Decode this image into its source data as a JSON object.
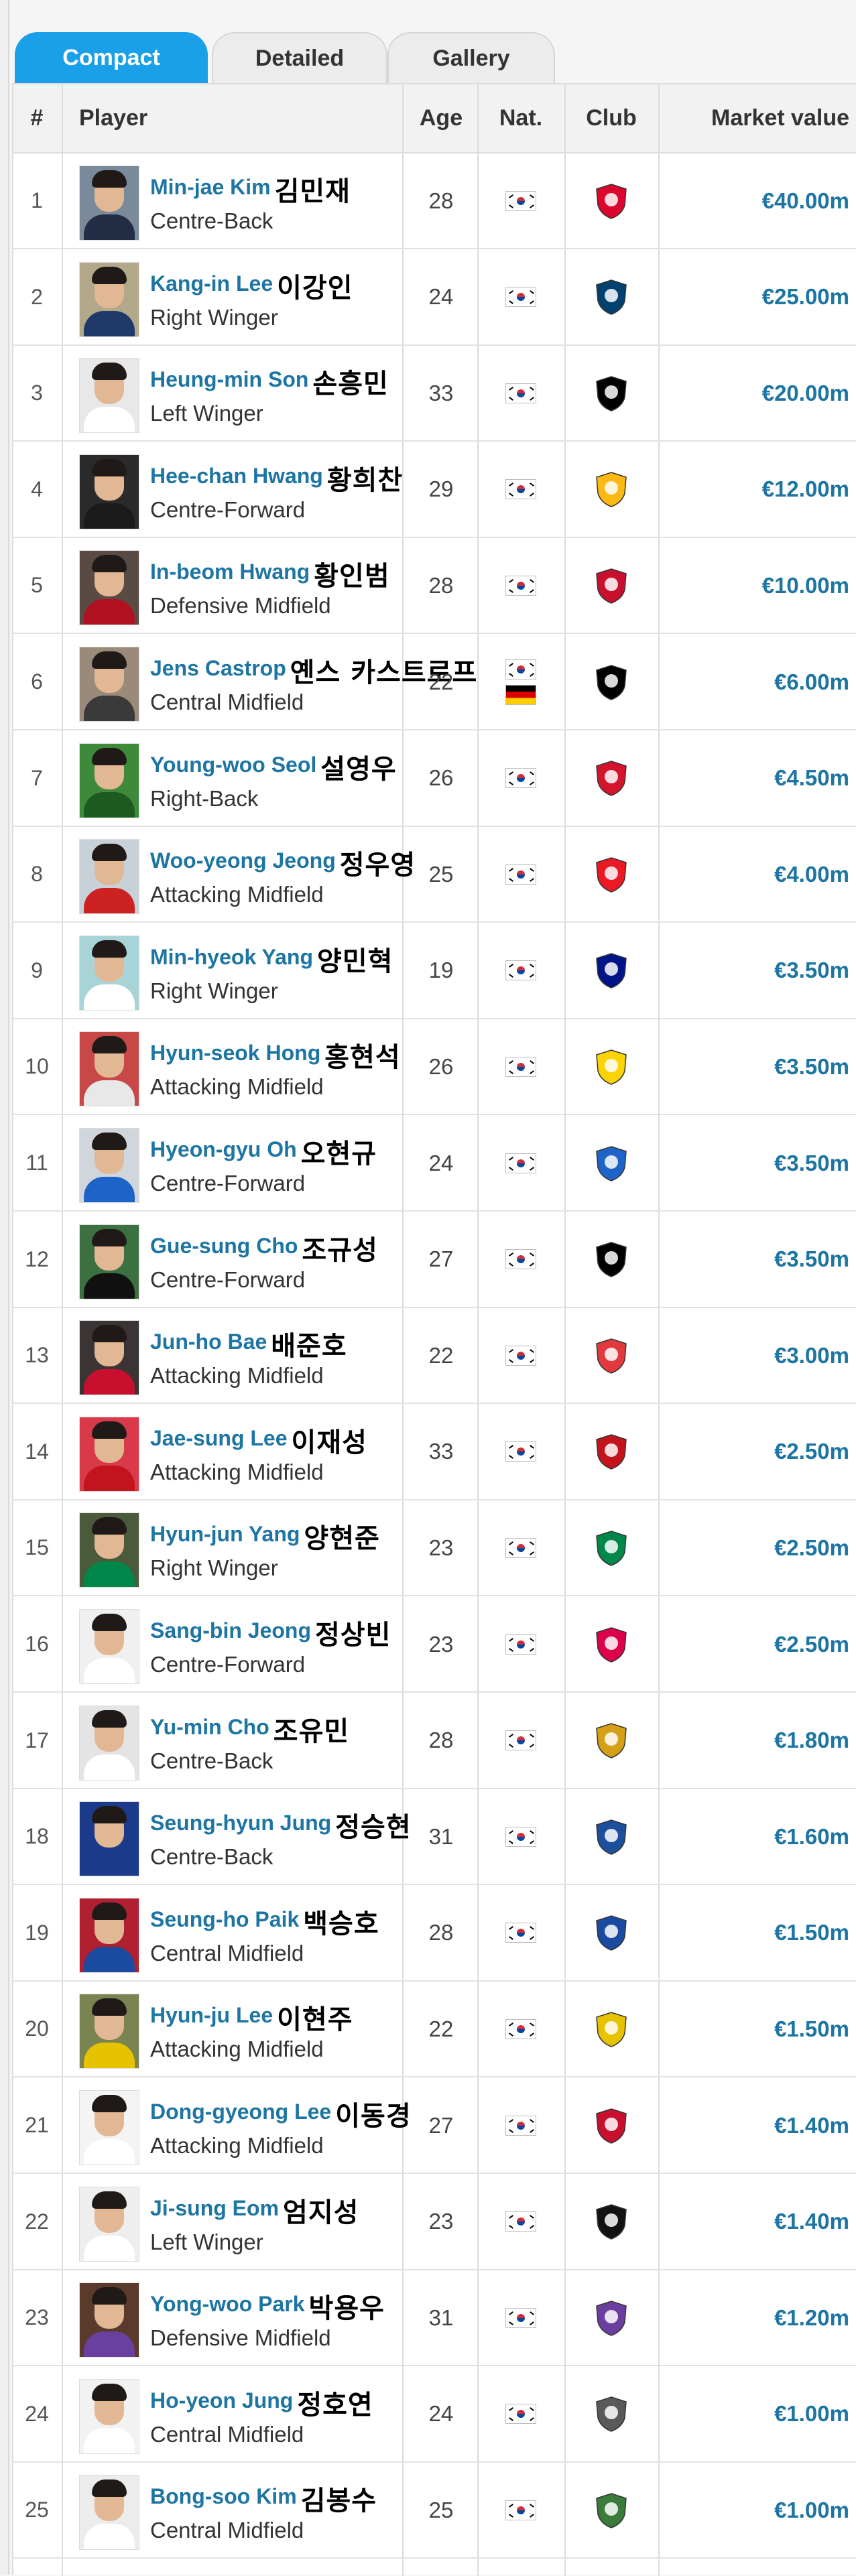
{
  "tabs": [
    {
      "label": "Compact",
      "active": true
    },
    {
      "label": "Detailed",
      "active": false
    },
    {
      "label": "Gallery",
      "active": false
    }
  ],
  "columns": {
    "num": "#",
    "player": "Player",
    "age": "Age",
    "nat": "Nat.",
    "club": "Club",
    "value": "Market value"
  },
  "rows": [
    {
      "num": "1",
      "name": "Min-jae Kim",
      "korean": "김민재",
      "position": "Centre-Back",
      "age": "28",
      "nationality": [
        "south-korea-flag"
      ],
      "club_icon": "bayern-munich-crest",
      "club_color": "#dc052d",
      "value": "€40.00m",
      "photo_bg": "#7a8a9a",
      "kit": "#222c44"
    },
    {
      "num": "2",
      "name": "Kang-in Lee",
      "korean": "이강인",
      "position": "Right Winger",
      "age": "24",
      "nationality": [
        "south-korea-flag"
      ],
      "club_icon": "psg-crest",
      "club_color": "#004170",
      "value": "€25.00m",
      "photo_bg": "#b3a88a",
      "kit": "#1f3a68"
    },
    {
      "num": "3",
      "name": "Heung-min Son",
      "korean": "손흥민",
      "position": "Left Winger",
      "age": "33",
      "nationality": [
        "south-korea-flag"
      ],
      "club_icon": "lafc-crest",
      "club_color": "#000000",
      "value": "€20.00m",
      "photo_bg": "#e8e8e8",
      "kit": "#ffffff"
    },
    {
      "num": "4",
      "name": "Hee-chan Hwang",
      "korean": "황희찬",
      "position": "Centre-Forward",
      "age": "29",
      "nationality": [
        "south-korea-flag"
      ],
      "club_icon": "wolves-crest",
      "club_color": "#fdb913",
      "value": "€12.00m",
      "photo_bg": "#2a2a2a",
      "kit": "#1a1a1a"
    },
    {
      "num": "5",
      "name": "In-beom Hwang",
      "korean": "황인범",
      "position": "Defensive Midfield",
      "age": "28",
      "nationality": [
        "south-korea-flag"
      ],
      "club_icon": "feyenoord-crest",
      "club_color": "#c8102e",
      "value": "€10.00m",
      "photo_bg": "#5a4a44",
      "kit": "#b01020"
    },
    {
      "num": "6",
      "name": "Jens Castrop",
      "korean": "옌스 카스트로프",
      "position": "Central Midfield",
      "age": "22",
      "nationality": [
        "south-korea-flag",
        "germany-flag"
      ],
      "club_icon": "gladbach-crest",
      "club_color": "#000000",
      "value": "€6.00m",
      "photo_bg": "#9a8a7a",
      "kit": "#3a3a3a"
    },
    {
      "num": "7",
      "name": "Young-woo Seol",
      "korean": "설영우",
      "position": "Right-Back",
      "age": "26",
      "nationality": [
        "south-korea-flag"
      ],
      "club_icon": "red-star-crest",
      "club_color": "#d4142a",
      "value": "€4.50m",
      "photo_bg": "#3f8a3a",
      "kit": "#1d5a20"
    },
    {
      "num": "8",
      "name": "Woo-yeong Jeong",
      "korean": "정우영",
      "position": "Attacking Midfield",
      "age": "25",
      "nationality": [
        "south-korea-flag"
      ],
      "club_icon": "union-berlin-crest",
      "club_color": "#eb1923",
      "value": "€4.00m",
      "photo_bg": "#c8d0d8",
      "kit": "#cc2222"
    },
    {
      "num": "9",
      "name": "Min-hyeok Yang",
      "korean": "양민혁",
      "position": "Right Winger",
      "age": "19",
      "nationality": [
        "south-korea-flag"
      ],
      "club_icon": "portsmouth-crest",
      "club_color": "#001489",
      "value": "€3.50m",
      "photo_bg": "#a8d4d8",
      "kit": "#ffffff"
    },
    {
      "num": "10",
      "name": "Hyun-seok Hong",
      "korean": "홍현석",
      "position": "Attacking Midfield",
      "age": "26",
      "nationality": [
        "south-korea-flag"
      ],
      "club_icon": "nantes-crest",
      "club_color": "#fcd405",
      "value": "€3.50m",
      "photo_bg": "#c84848",
      "kit": "#e8e8e8"
    },
    {
      "num": "11",
      "name": "Hyeon-gyu Oh",
      "korean": "오현규",
      "position": "Centre-Forward",
      "age": "24",
      "nationality": [
        "south-korea-flag"
      ],
      "club_icon": "genk-crest",
      "club_color": "#1e64c8",
      "value": "€3.50m",
      "photo_bg": "#d0d6dc",
      "kit": "#1e64c8"
    },
    {
      "num": "12",
      "name": "Gue-sung Cho",
      "korean": "조규성",
      "position": "Centre-Forward",
      "age": "27",
      "nationality": [
        "south-korea-flag"
      ],
      "club_icon": "midtjylland-crest",
      "club_color": "#000000",
      "value": "€3.50m",
      "photo_bg": "#3c7040",
      "kit": "#111111"
    },
    {
      "num": "13",
      "name": "Jun-ho Bae",
      "korean": "배준호",
      "position": "Attacking Midfield",
      "age": "22",
      "nationality": [
        "south-korea-flag"
      ],
      "club_icon": "stoke-crest",
      "club_color": "#e03a3e",
      "value": "€3.00m",
      "photo_bg": "#3a3434",
      "kit": "#c8102e"
    },
    {
      "num": "14",
      "name": "Jae-sung Lee",
      "korean": "이재성",
      "position": "Attacking Midfield",
      "age": "33",
      "nationality": [
        "south-korea-flag"
      ],
      "club_icon": "mainz-crest",
      "club_color": "#c3141e",
      "value": "€2.50m",
      "photo_bg": "#d83a4a",
      "kit": "#c3141e"
    },
    {
      "num": "15",
      "name": "Hyun-jun Yang",
      "korean": "양현준",
      "position": "Right Winger",
      "age": "23",
      "nationality": [
        "south-korea-flag"
      ],
      "club_icon": "celtic-crest",
      "club_color": "#018749",
      "value": "€2.50m",
      "photo_bg": "#4a5a3a",
      "kit": "#018749"
    },
    {
      "num": "16",
      "name": "Sang-bin Jeong",
      "korean": "정상빈",
      "position": "Centre-Forward",
      "age": "23",
      "nationality": [
        "south-korea-flag"
      ],
      "club_icon": "st-louis-city-crest",
      "club_color": "#dd004a",
      "value": "€2.50m",
      "photo_bg": "#f0f0f0",
      "kit": "#ffffff"
    },
    {
      "num": "17",
      "name": "Yu-min Cho",
      "korean": "조유민",
      "position": "Centre-Back",
      "age": "28",
      "nationality": [
        "south-korea-flag"
      ],
      "club_icon": "sharjah-crest",
      "club_color": "#d4a017",
      "value": "€1.80m",
      "photo_bg": "#e4e4e4",
      "kit": "#ffffff"
    },
    {
      "num": "18",
      "name": "Seung-hyun Jung",
      "korean": "정승현",
      "position": "Centre-Back",
      "age": "31",
      "nationality": [
        "south-korea-flag"
      ],
      "club_icon": "al-wasl-crest",
      "club_color": "#1c4f9c",
      "value": "€1.60m",
      "photo_bg": "#1c3a8a",
      "kit": "#1c3a8a"
    },
    {
      "num": "19",
      "name": "Seung-ho Paik",
      "korean": "백승호",
      "position": "Central Midfield",
      "age": "28",
      "nationality": [
        "south-korea-flag"
      ],
      "club_icon": "birmingham-crest",
      "club_color": "#1a4ba0",
      "value": "€1.50m",
      "photo_bg": "#b02030",
      "kit": "#1a4ba0"
    },
    {
      "num": "20",
      "name": "Hyun-ju Lee",
      "korean": "이현주",
      "position": "Attacking Midfield",
      "age": "22",
      "nationality": [
        "south-korea-flag"
      ],
      "club_icon": "arouca-crest",
      "club_color": "#e6c200",
      "value": "€1.50m",
      "photo_bg": "#7a8450",
      "kit": "#e6c200"
    },
    {
      "num": "21",
      "name": "Dong-gyeong Lee",
      "korean": "이동경",
      "position": "Attacking Midfield",
      "age": "27",
      "nationality": [
        "south-korea-flag"
      ],
      "club_icon": "gimcheon-crest",
      "club_color": "#c8102e",
      "value": "€1.40m",
      "photo_bg": "#f4f4f4",
      "kit": "#ffffff"
    },
    {
      "num": "22",
      "name": "Ji-sung Eom",
      "korean": "엄지성",
      "position": "Left Winger",
      "age": "23",
      "nationality": [
        "south-korea-flag"
      ],
      "club_icon": "swansea-crest",
      "club_color": "#121212",
      "value": "€1.40m",
      "photo_bg": "#eeeeee",
      "kit": "#ffffff"
    },
    {
      "num": "23",
      "name": "Yong-woo Park",
      "korean": "박용우",
      "position": "Defensive Midfield",
      "age": "31",
      "nationality": [
        "south-korea-flag"
      ],
      "club_icon": "al-ain-crest",
      "club_color": "#6a3fa0",
      "value": "€1.20m",
      "photo_bg": "#5a3a2a",
      "kit": "#6a3fa0"
    },
    {
      "num": "24",
      "name": "Ho-yeon Jung",
      "korean": "정호연",
      "position": "Central Midfield",
      "age": "24",
      "nationality": [
        "south-korea-flag"
      ],
      "club_icon": "minnesota-united-crest",
      "club_color": "#585958",
      "value": "€1.00m",
      "photo_bg": "#f2f2f2",
      "kit": "#ffffff"
    },
    {
      "num": "25",
      "name": "Bong-soo Kim",
      "korean": "김봉수",
      "position": "Central Midfield",
      "age": "25",
      "nationality": [
        "south-korea-flag"
      ],
      "club_icon": "daejeon-crest",
      "club_color": "#3a7a3a",
      "value": "€1.00m",
      "photo_bg": "#ececec",
      "kit": "#ffffff"
    }
  ]
}
